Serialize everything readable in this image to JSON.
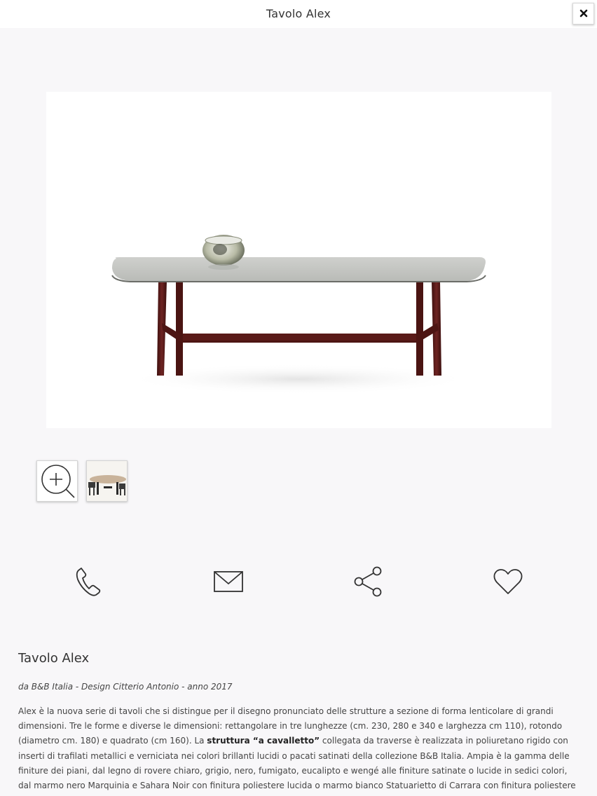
{
  "header": {
    "title": "Tavolo Alex",
    "close_icon": "close-icon"
  },
  "gallery": {
    "main_image_alt": "Tavolo Alex",
    "thumbs": [
      {
        "icon": "zoom-in-icon"
      },
      {
        "image": "table-thumbnail"
      }
    ]
  },
  "actions": [
    {
      "icon": "phone-icon"
    },
    {
      "icon": "mail-icon"
    },
    {
      "icon": "share-icon"
    },
    {
      "icon": "heart-icon"
    }
  ],
  "product": {
    "title": "Tavolo Alex",
    "byline": "da B&B Italia - Design Citterio Antonio - anno 2017",
    "description": {
      "part1": "Alex è la nuova serie di tavoli che si distingue per il disegno pronunciato delle strutture a sezione di forma lenticolare di grandi dimensioni. Tre le forme e diverse le dimensioni: rettangolare in tre lunghezze (cm. 230, 280 e 340 e larghezza cm 110), rotondo (diametro cm. 180) e quadrato (cm 160). La ",
      "bold": "struttura “a cavalletto”",
      "part2": " collegata da traverse è realizzata in poliuretano rigido con inserti di trafilati metallici e verniciata nei colori brillanti lucidi o pacati satinati della collezione B&B Italia. Ampia è la gamma delle finiture dei piani, dal legno di rovere chiaro, grigio, nero, fumigato, eucalipto e wengé alle finiture satinate o lucide in sedici colori, dal marmo nero Marquinia e Sahara Noir con finitura poliestere lucida o marmo bianco Statuarietto di Carrara con finitura poliestere opaca fino al vetro a specchio bronzo o grigio. La"
    }
  },
  "colors": {
    "background": "#f8f7f9",
    "frame": "#5b1c1a",
    "glass_top": "#c4c6c2"
  }
}
